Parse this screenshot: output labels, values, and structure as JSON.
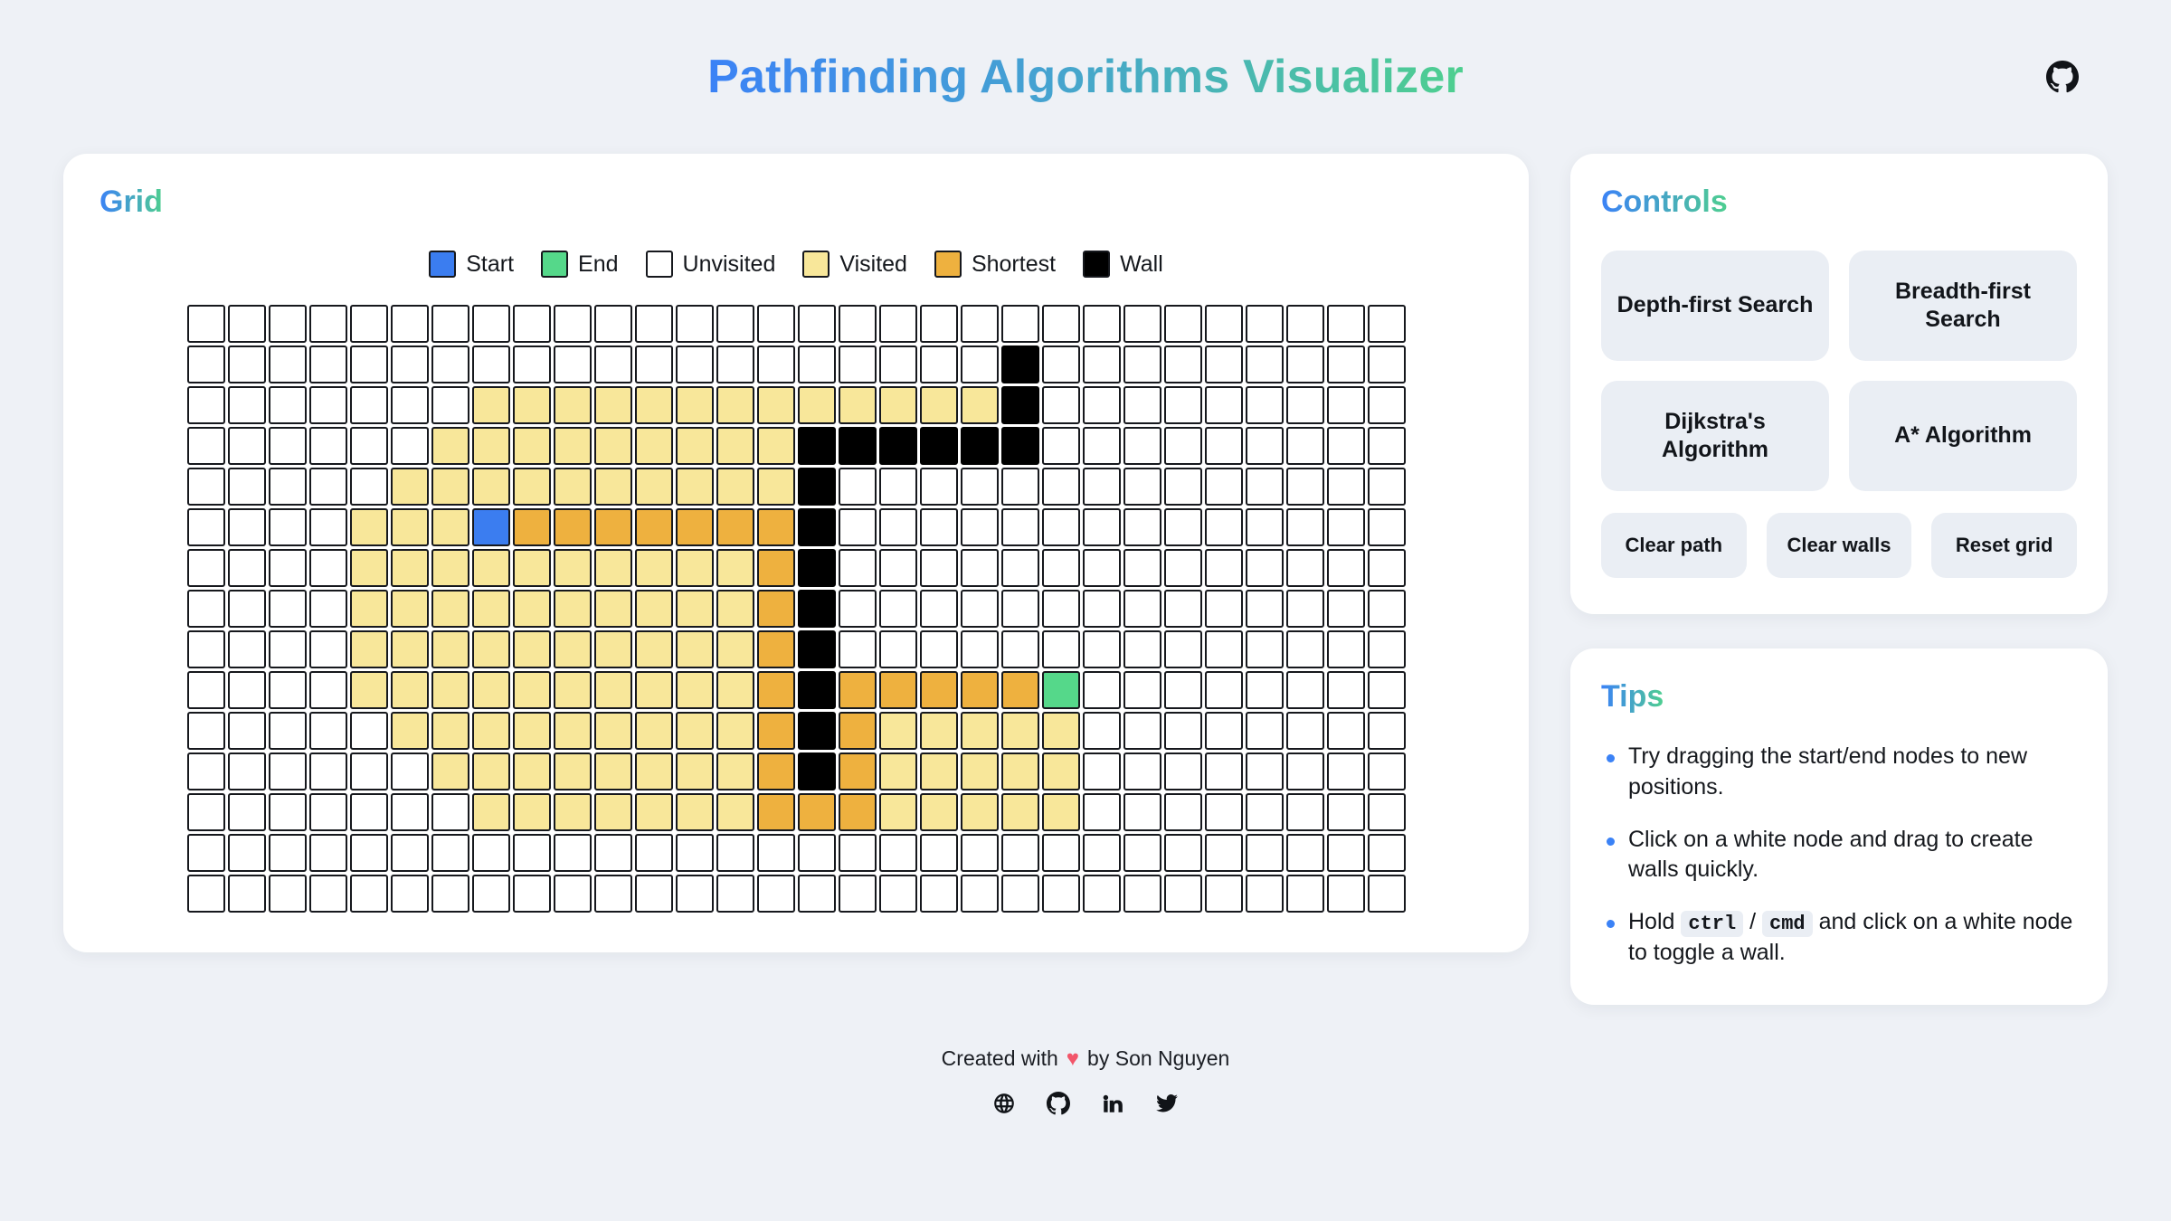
{
  "header": {
    "title": "Pathfinding Algorithms Visualizer",
    "github_icon": "github-icon"
  },
  "grid_panel": {
    "title": "Grid",
    "legend": [
      {
        "label": "Start",
        "color": "#3b7df0"
      },
      {
        "label": "End",
        "color": "#55d88a"
      },
      {
        "label": "Unvisited",
        "color": "#ffffff"
      },
      {
        "label": "Visited",
        "color": "#f8e79a"
      },
      {
        "label": "Shortest",
        "color": "#eeb13f"
      },
      {
        "label": "Wall",
        "color": "#000000"
      }
    ],
    "grid": {
      "rows": 15,
      "cols": 30,
      "legend_key": {
        "u": "unvisited",
        "v": "visited",
        "s": "shortest",
        "w": "wall",
        "S": "start",
        "E": "end"
      },
      "start": {
        "row": 5,
        "col": 7
      },
      "end": {
        "row": 9,
        "col": 21
      },
      "cells": [
        "uuuuuuuuuuuuuuuuuuuuuuuuuuuuuu",
        "uuuuuuuuuuuuuuuuuuuuwuuuuuuuuu",
        "uuuuuuuvvvvvvvvvvvvvwuuuuuuuuu",
        "uuuuuuvvvvvvvvvwwwwwwuuuuuuuuu",
        "uuuuuvvvvvvvvvvwuuuuuuuuuuuuuu",
        "uuuuvvvSssssssswuuuuuuuuuuuuuu",
        "uuuuvvvvvvvvvvswuuuuuuuuuuuuuu",
        "uuuuvvvvvvvvvvswuuuuuuuuuuuuuu",
        "uuuuvvvvvvvvvvswuuuuuuuuuuuuuu",
        "uuuuvvvvvvvvvvswsssssEuuuuuuuu",
        "uuuuuvvvvvvvvvswsvvvvvuuuuuuuu",
        "uuuuuuvvvvvvvvswsvvvvvuuuuuuuu",
        "uuuuuuuvvvvvvvsssvvvvvuuuuuuuu",
        "uuuuuuuuuuuuuuuuuuuuuuuuuuuuuu",
        "uuuuuuuuuuuuuuuuuuuuuuuuuuuuuu"
      ]
    }
  },
  "controls": {
    "title": "Controls",
    "algorithms": [
      "Depth-first Search",
      "Breadth-first Search",
      "Dijkstra's Algorithm",
      "A* Algorithm"
    ],
    "actions": [
      "Clear path",
      "Clear walls",
      "Reset grid"
    ]
  },
  "tips": {
    "title": "Tips",
    "items": [
      {
        "text": "Try dragging the start/end nodes to new positions."
      },
      {
        "text": "Click on a white node and drag to create walls quickly."
      },
      {
        "prefix": "Hold ",
        "key1": "ctrl",
        "separator": " / ",
        "key2": "cmd",
        "suffix": " and click on a white node to toggle a wall."
      }
    ]
  },
  "footer": {
    "prefix": "Created with",
    "heart": "♥",
    "suffix": "by Son Nguyen",
    "social": [
      "globe-icon",
      "github-icon",
      "linkedin-icon",
      "twitter-icon"
    ]
  }
}
